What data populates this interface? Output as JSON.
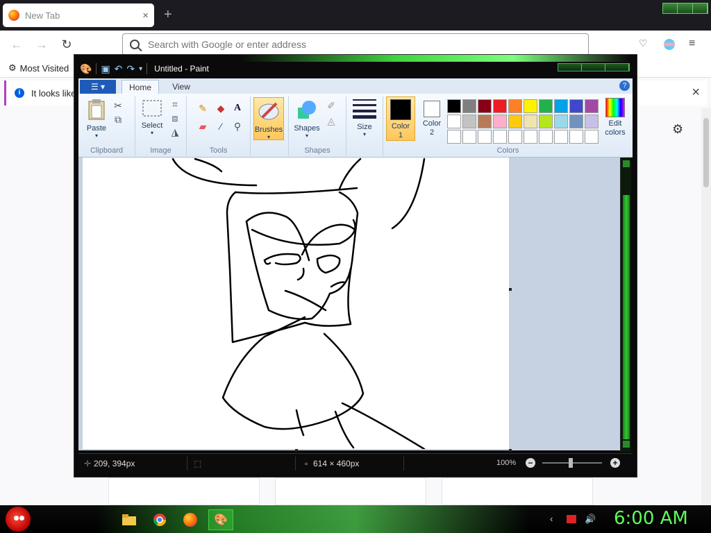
{
  "browser": {
    "tab_title": "New Tab",
    "tab_close": "×",
    "new_tab": "+",
    "address_placeholder": "Search with Google or enter address",
    "bookmarks": {
      "most_visited": "Most Visited"
    },
    "notice": {
      "text": "It looks like",
      "close": "×"
    }
  },
  "paint": {
    "title": "Untitled - Paint",
    "tabs": {
      "file_icon": "☰ ▾",
      "home": "Home",
      "view": "View"
    },
    "help": "?",
    "groups": {
      "clipboard": {
        "name": "Clipboard",
        "paste": "Paste"
      },
      "image": {
        "name": "Image",
        "select": "Select"
      },
      "tools": {
        "name": "Tools"
      },
      "brushes": {
        "label": "Brushes"
      },
      "shapes": {
        "name": "Shapes",
        "label": "Shapes"
      },
      "size": {
        "label": "Size"
      },
      "colors": {
        "name": "Colors",
        "color1": "Color 1",
        "color2": "Color 2",
        "edit": "Edit colors",
        "color1_value": "#000000",
        "color2_value": "#ffffff",
        "palette": [
          "#000000",
          "#7f7f7f",
          "#880015",
          "#ed1c24",
          "#ff7f27",
          "#fff200",
          "#22b14c",
          "#00a2e8",
          "#3f48cc",
          "#a349a4",
          "#ffffff",
          "#c3c3c3",
          "#b97a57",
          "#ffaec9",
          "#ffc90e",
          "#efe4b0",
          "#b5e61d",
          "#99d9ea",
          "#7092be",
          "#c8bfe7",
          "#ffffff",
          "#ffffff",
          "#ffffff",
          "#ffffff",
          "#ffffff",
          "#ffffff",
          "#ffffff",
          "#ffffff",
          "#ffffff",
          "#ffffff"
        ]
      }
    },
    "status": {
      "cursor_pos": "209, 394px",
      "image_size": "614 × 460px",
      "zoom": "100%",
      "zoom_out": "−",
      "zoom_in": "+"
    }
  },
  "taskbar": {
    "clock": "6:00 AM"
  }
}
